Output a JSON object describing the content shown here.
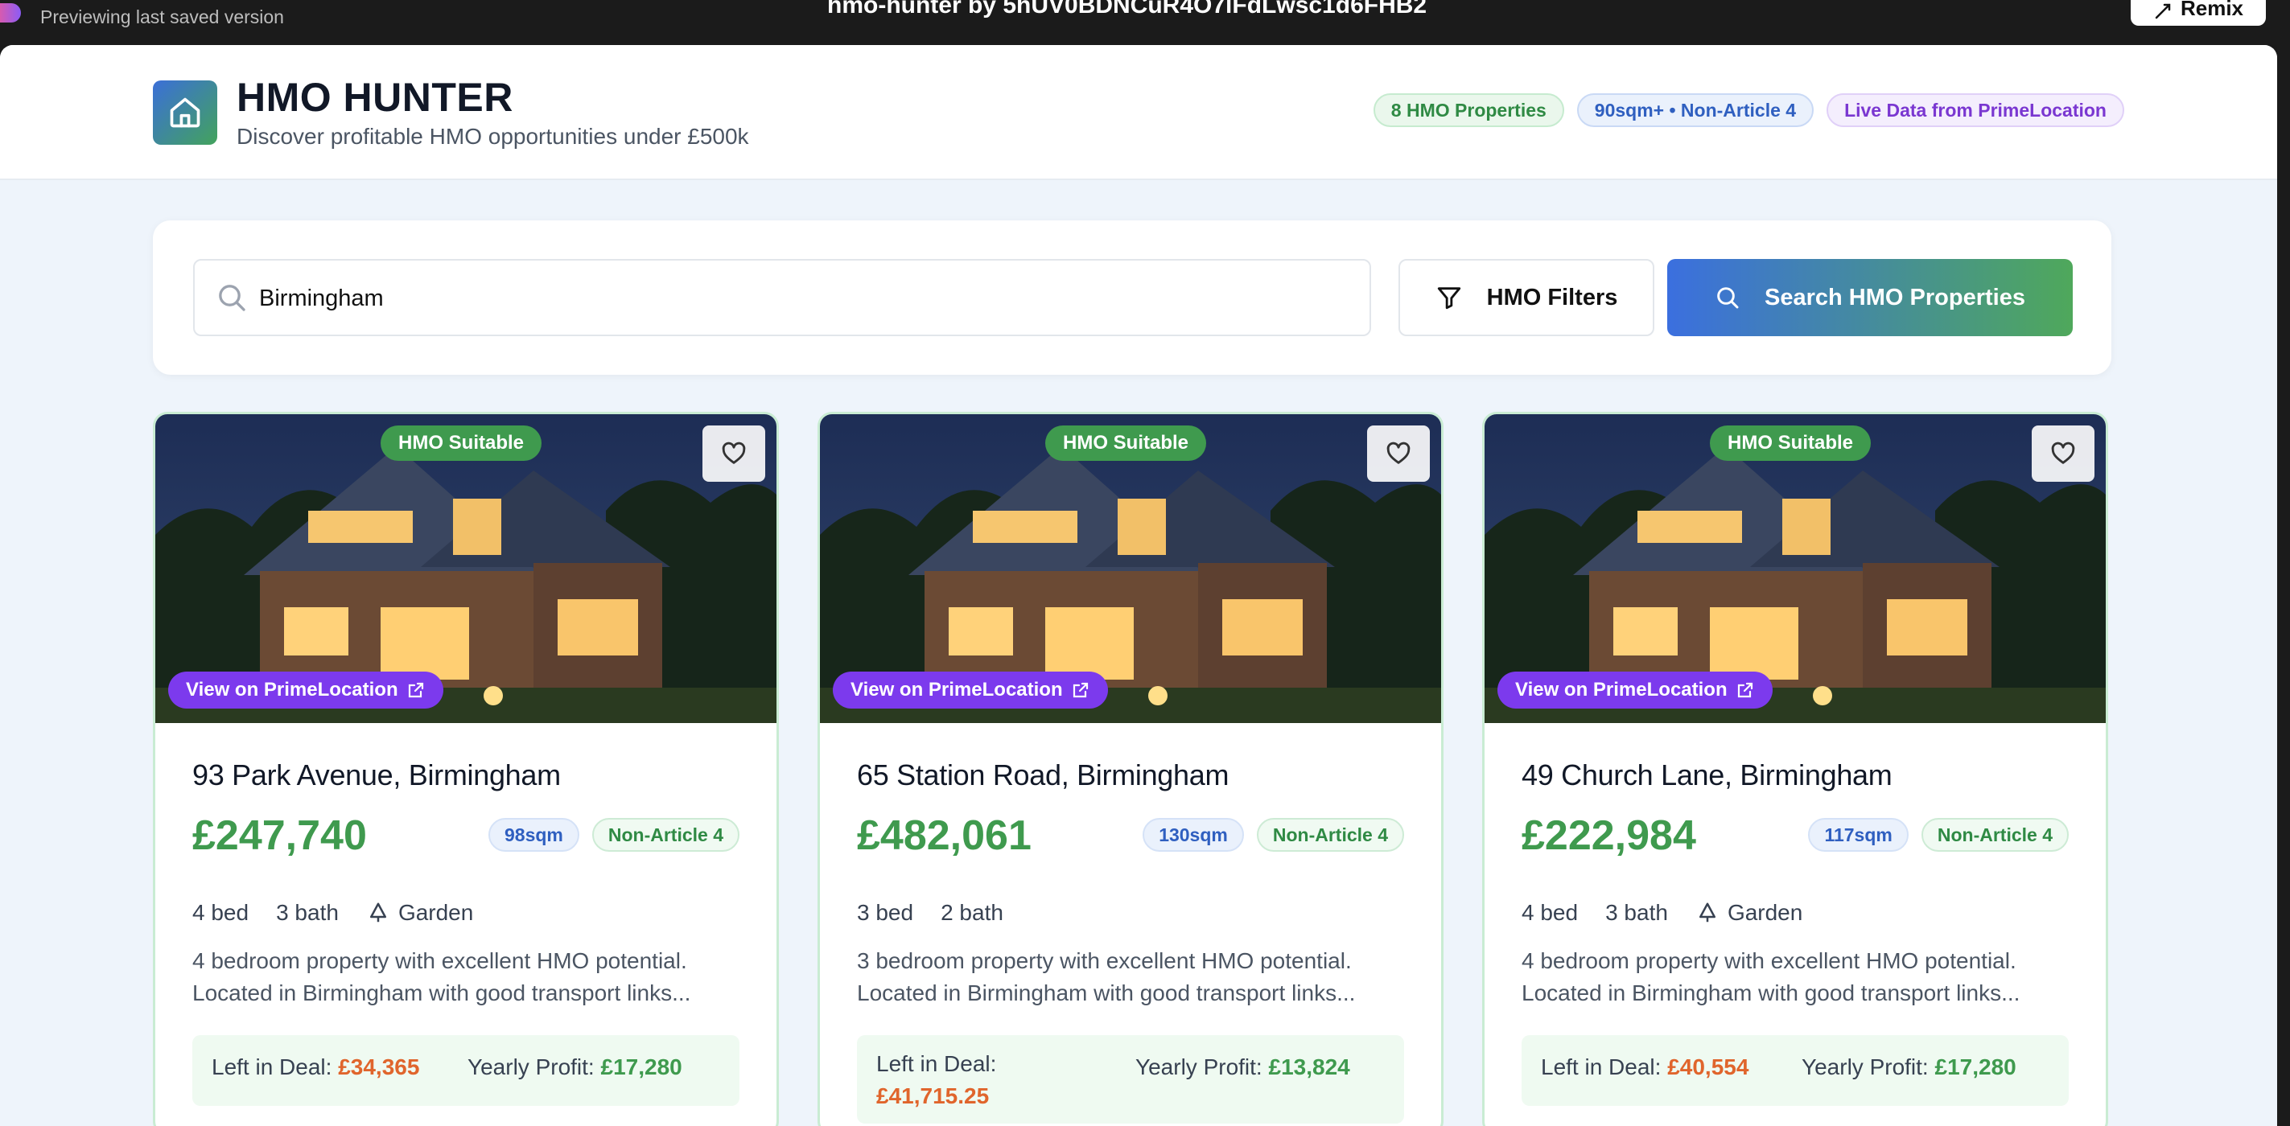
{
  "topbar": {
    "preview_text": "Previewing last saved version",
    "title": "hmo-hunter by 5hUV0BDNCuR4O7lFdLwsc1d6FHB2",
    "remix_label": "Remix"
  },
  "header": {
    "title": "HMO HUNTER",
    "subtitle": "Discover profitable HMO opportunities under £500k",
    "badges": [
      "8 HMO Properties",
      "90sqm+ • Non-Article 4",
      "Live Data from PrimeLocation"
    ]
  },
  "search": {
    "value": "Birmingham",
    "filters_label": "HMO Filters",
    "search_label": "Search HMO Properties"
  },
  "properties": [
    {
      "suitable_label": "HMO Suitable",
      "view_label": "View on PrimeLocation",
      "address": "93 Park Avenue, Birmingham",
      "price": "£247,740",
      "size": "98sqm",
      "article": "Non-Article 4",
      "beds": "4 bed",
      "baths": "3 bath",
      "extra": "Garden",
      "description": "4 bedroom property with excellent HMO potential. Located in Birmingham with good transport links...",
      "left_in_deal_label": "Left in Deal:",
      "left_in_deal": "£34,365",
      "yearly_profit_label": "Yearly Profit:",
      "yearly_profit": "£17,280"
    },
    {
      "suitable_label": "HMO Suitable",
      "view_label": "View on PrimeLocation",
      "address": "65 Station Road, Birmingham",
      "price": "£482,061",
      "size": "130sqm",
      "article": "Non-Article 4",
      "beds": "3 bed",
      "baths": "2 bath",
      "extra": "",
      "description": "3 bedroom property with excellent HMO potential. Located in Birmingham with good transport links...",
      "left_in_deal_label": "Left in Deal:",
      "left_in_deal": "£41,715.25",
      "yearly_profit_label": "Yearly Profit:",
      "yearly_profit": "£13,824"
    },
    {
      "suitable_label": "HMO Suitable",
      "view_label": "View on PrimeLocation",
      "address": "49 Church Lane, Birmingham",
      "price": "£222,984",
      "size": "117sqm",
      "article": "Non-Article 4",
      "beds": "4 bed",
      "baths": "3 bath",
      "extra": "Garden",
      "description": "4 bedroom property with excellent HMO potential. Located in Birmingham with good transport links...",
      "left_in_deal_label": "Left in Deal:",
      "left_in_deal": "£40,554",
      "yearly_profit_label": "Yearly Profit:",
      "yearly_profit": "£17,280"
    }
  ],
  "colors": {
    "accent_green": "#3f9a4e",
    "accent_blue": "#3b6fdf",
    "accent_purple": "#7c3aed",
    "deal_orange": "#e0652c"
  }
}
